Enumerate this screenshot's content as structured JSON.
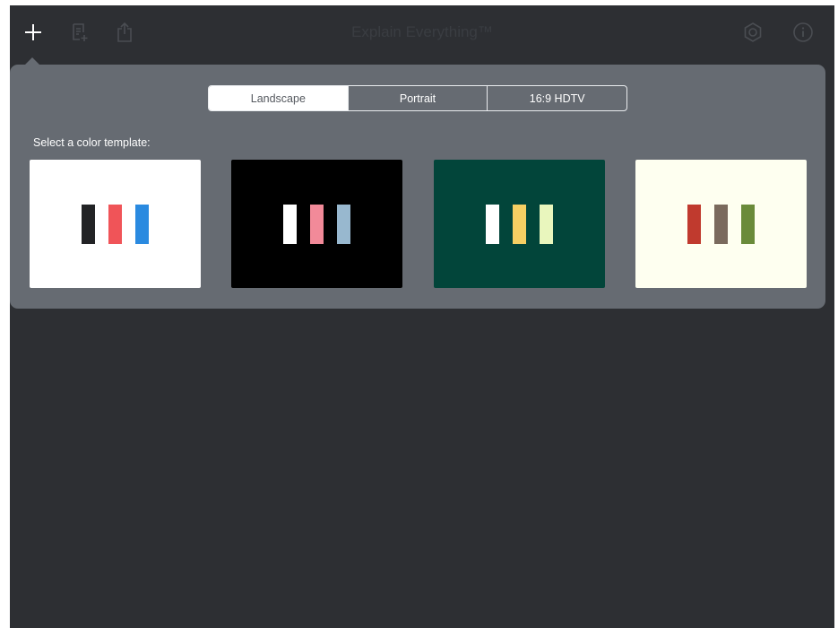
{
  "app": {
    "title": "Explain Everything™",
    "background": "#2d2f33"
  },
  "toolbar": {
    "left": [
      {
        "icon": "plus-icon",
        "color": "#ffffff"
      },
      {
        "icon": "new-document-icon",
        "color": "#4a4d52"
      },
      {
        "icon": "share-icon",
        "color": "#4a4d52"
      }
    ],
    "right": [
      {
        "icon": "gear-icon",
        "color": "#4a4d52"
      },
      {
        "icon": "info-icon",
        "color": "#4a4d52"
      }
    ]
  },
  "popover": {
    "background": "#666b72",
    "orientation": {
      "options": [
        "Landscape",
        "Portrait",
        "16:9 HDTV"
      ],
      "selected": "Landscape"
    },
    "template_label": "Select a color template:",
    "templates": [
      {
        "name": "white",
        "background": "#ffffff",
        "bars": [
          "#222325",
          "#f05458",
          "#2a8ae0"
        ]
      },
      {
        "name": "black",
        "background": "#000000",
        "bars": [
          "#ffffff",
          "#f28a99",
          "#98b8cf"
        ]
      },
      {
        "name": "green",
        "background": "#02453a",
        "bars": [
          "#ffffff",
          "#f6cf63",
          "#e9f6bd"
        ]
      },
      {
        "name": "cream",
        "background": "#fefff0",
        "bars": [
          "#c03a2e",
          "#7a6a5d",
          "#6a8b3a"
        ]
      }
    ]
  }
}
